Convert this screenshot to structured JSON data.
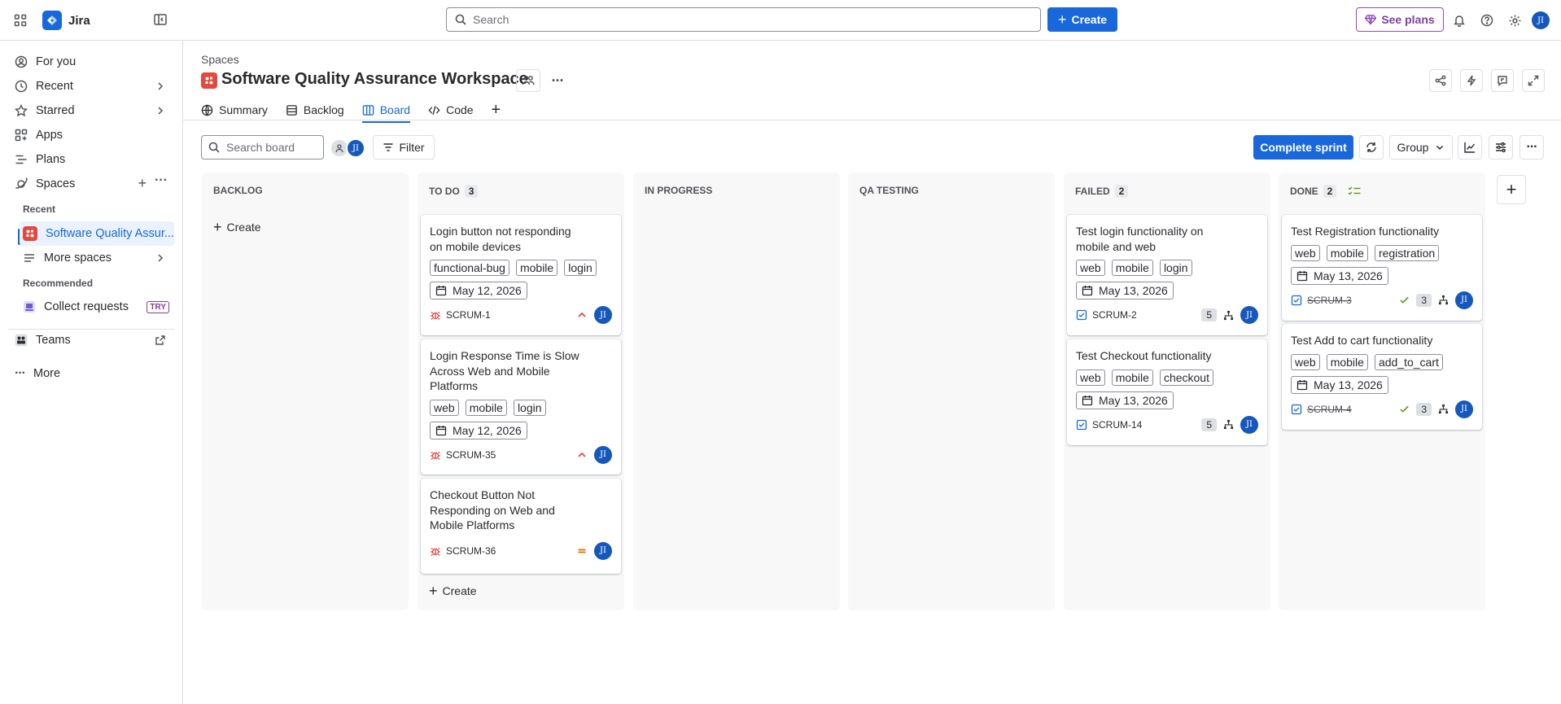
{
  "app": {
    "name": "Jira"
  },
  "topbar": {
    "search_placeholder": "Search",
    "create_label": "Create",
    "see_plans_label": "See plans",
    "user_initials": "JI"
  },
  "sidebar": {
    "items": [
      {
        "label": "For you",
        "icon": "user-circle-icon"
      },
      {
        "label": "Recent",
        "icon": "clock-icon"
      },
      {
        "label": "Starred",
        "icon": "star-icon"
      },
      {
        "label": "Apps",
        "icon": "apps-icon"
      },
      {
        "label": "Plans",
        "icon": "plans-icon"
      },
      {
        "label": "Spaces",
        "icon": "planet-icon"
      }
    ],
    "recent_heading": "Recent",
    "recent_space": "Software Quality Assur...",
    "more_spaces": "More spaces",
    "recommended_heading": "Recommended",
    "collect_requests": "Collect requests",
    "try_badge": "TRY",
    "teams": "Teams",
    "more": "More"
  },
  "project": {
    "breadcrumb": "Spaces",
    "title": "Software Quality Assurance Workspace",
    "tabs": [
      "Summary",
      "Backlog",
      "Board",
      "Code"
    ],
    "active_tab": "Board"
  },
  "toolbar": {
    "search_placeholder": "Search board",
    "filter_label": "Filter",
    "complete_sprint_label": "Complete sprint",
    "group_label": "Group",
    "user_initials": "JI"
  },
  "columns": [
    {
      "name": "BACKLOG",
      "count": "",
      "create_label": "Create"
    },
    {
      "name": "TO DO",
      "count": "3",
      "create_label": "Create"
    },
    {
      "name": "IN PROGRESS",
      "count": ""
    },
    {
      "name": "QA TESTING",
      "count": ""
    },
    {
      "name": "FAILED",
      "count": "2"
    },
    {
      "name": "DONE",
      "count": "2"
    }
  ],
  "cards": {
    "todo": [
      {
        "title": "Login button not responding on mobile devices",
        "labels": [
          "functional-bug",
          "mobile",
          "login"
        ],
        "date": "May 12, 2026",
        "key": "SCRUM-1",
        "type": "bug",
        "priority": "high",
        "assignee": "JI"
      },
      {
        "title": "Login Response Time is Slow Across Web and Mobile Platforms",
        "labels": [
          "web",
          "mobile",
          "login"
        ],
        "date": "May 12, 2026",
        "key": "SCRUM-35",
        "type": "bug",
        "priority": "high",
        "assignee": "JI"
      },
      {
        "title": "Checkout Button Not Responding on Web and Mobile Platforms",
        "labels": [],
        "date": "",
        "key": "SCRUM-36",
        "type": "bug",
        "priority": "medium",
        "assignee": "JI"
      }
    ],
    "failed": [
      {
        "title": "Test login functionality on mobile and web",
        "labels": [
          "web",
          "mobile",
          "login"
        ],
        "date": "May 13, 2026",
        "key": "SCRUM-2",
        "type": "task",
        "estimate": "5",
        "assignee": "JI"
      },
      {
        "title": "Test Checkout functionality",
        "labels": [
          "web",
          "mobile",
          "checkout"
        ],
        "date": "May 13, 2026",
        "key": "SCRUM-14",
        "type": "task",
        "estimate": "5",
        "assignee": "JI"
      }
    ],
    "done": [
      {
        "title": "Test Registration functionality",
        "labels": [
          "web",
          "mobile",
          "registration"
        ],
        "date": "May 13, 2026",
        "key": "SCRUM-3",
        "type": "task",
        "estimate": "3",
        "assignee": "JI"
      },
      {
        "title": "Test Add to cart functionality",
        "labels": [
          "web",
          "mobile",
          "add_to_cart"
        ],
        "date": "May 13, 2026",
        "key": "SCRUM-4",
        "type": "task",
        "estimate": "3",
        "assignee": "JI"
      }
    ]
  },
  "colors": {
    "accent": "#1868db",
    "bug": "#e2483d",
    "priority_high": "#e2483d",
    "priority_medium": "#e06c00",
    "done_check": "#6a9a23",
    "plans_purple": "#964ac0"
  }
}
